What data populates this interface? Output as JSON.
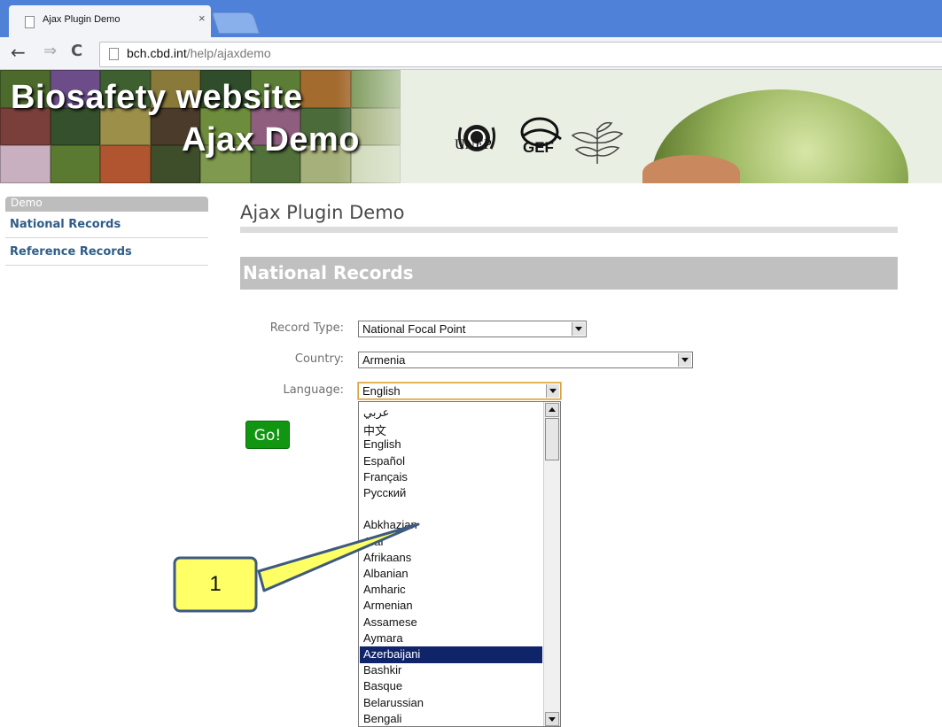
{
  "browser": {
    "tab_title": "Ajax Plugin Demo",
    "tab_close": "×",
    "url_host": "bch.cbd.int",
    "url_path": "/help/ajaxdemo"
  },
  "banner": {
    "title_line1": "Biosafety website",
    "title_line2": "Ajax Demo",
    "logo_unep": "UNEP",
    "logo_gef": "GEF"
  },
  "sidebar": {
    "header": "Demo",
    "items": [
      {
        "label": "National Records"
      },
      {
        "label": "Reference Records"
      }
    ]
  },
  "main": {
    "page_title": "Ajax Plugin Demo",
    "section_title": "National Records",
    "form": {
      "record_type_label": "Record Type:",
      "record_type_value": "National Focal Point",
      "country_label": "Country:",
      "country_value": "Armenia",
      "language_label": "Language:",
      "language_value": "English",
      "go_label": "Go!"
    },
    "language_options": [
      "عربي",
      "中文",
      "English",
      "Español",
      "Français",
      "Русский",
      "",
      "Abkhazian",
      "Afar",
      "Afrikaans",
      "Albanian",
      "Amharic",
      "Armenian",
      "Assamese",
      "Aymara",
      "Azerbaijani",
      "Bashkir",
      "Basque",
      "Belarussian",
      "Bengali"
    ],
    "selected_option": "Azerbaijani"
  },
  "annotation": {
    "callout_label": "1"
  },
  "colors": {
    "tabbar": "#4f81d8",
    "section_bar": "#c0c0c0",
    "go_button": "#119611",
    "link": "#2f5d88",
    "selected_option": "#10246a",
    "callout_fill": "#ffff66",
    "callout_stroke": "#3d5a80"
  }
}
